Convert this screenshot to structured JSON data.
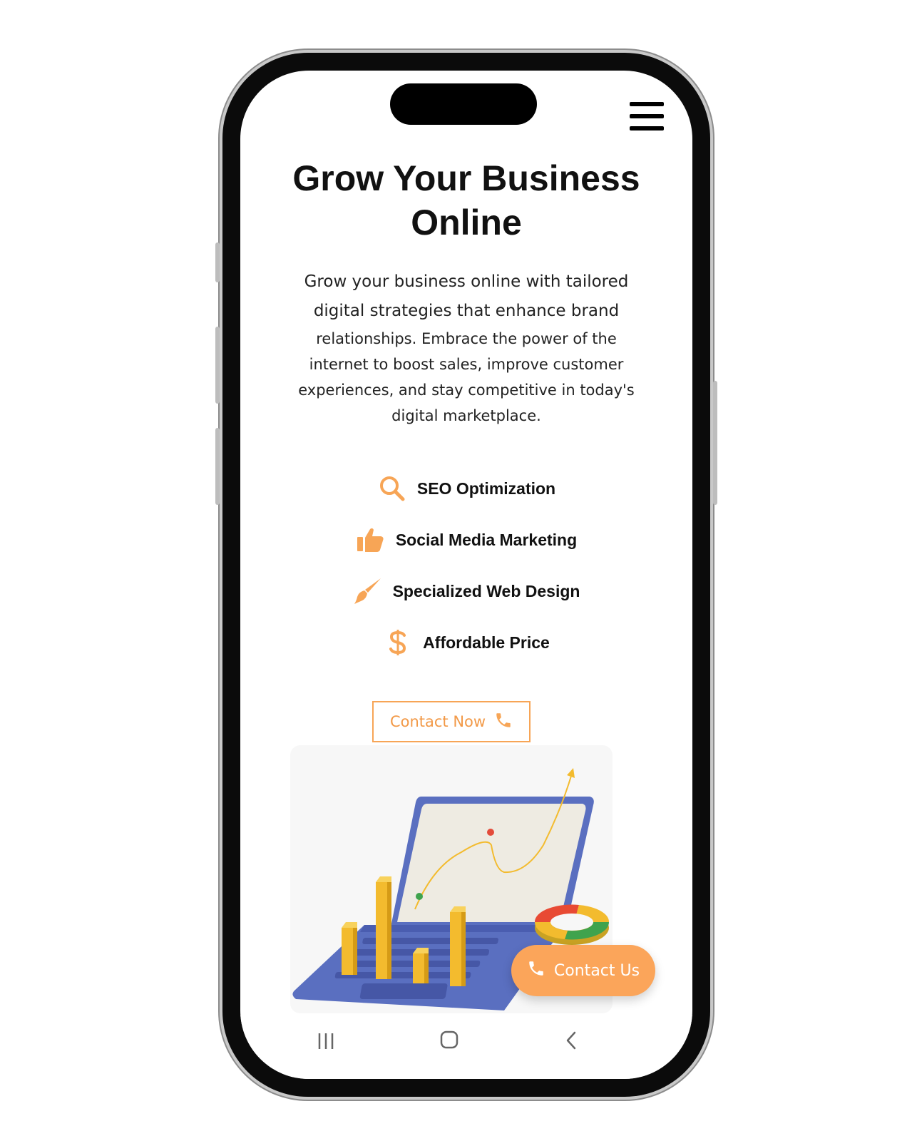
{
  "header": {
    "menu_icon": "hamburger-menu-icon"
  },
  "hero": {
    "title_line1": "Grow Your Business",
    "title_line2": "Online",
    "description_lines": [
      "Grow your business online with tailored",
      "digital strategies that enhance brand",
      "relationships. Embrace the power of the",
      "internet to boost sales, improve customer",
      "experiences, and stay competitive in today's",
      "digital marketplace."
    ]
  },
  "features": [
    {
      "label": "SEO Optimization",
      "icon": "search-icon"
    },
    {
      "label": "Social Media Marketing",
      "icon": "thumbs-up-icon"
    },
    {
      "label": "Specialized Web Design",
      "icon": "paint-brush-icon"
    },
    {
      "label": "Affordable Price",
      "icon": "dollar-icon"
    }
  ],
  "cta": {
    "label": "Contact Now",
    "icon": "phone-icon"
  },
  "floating_button": {
    "label": "Contact Us",
    "icon": "phone-icon"
  },
  "android_nav": {
    "recents_icon": "recents-icon",
    "home_icon": "home-icon",
    "back_icon": "back-icon"
  },
  "colors": {
    "accent": "#f7a556",
    "fab_background": "#fba55a",
    "text": "#111111",
    "laptop_blue": "#5a6fc0",
    "bar_yellow": "#f3bb2e"
  }
}
